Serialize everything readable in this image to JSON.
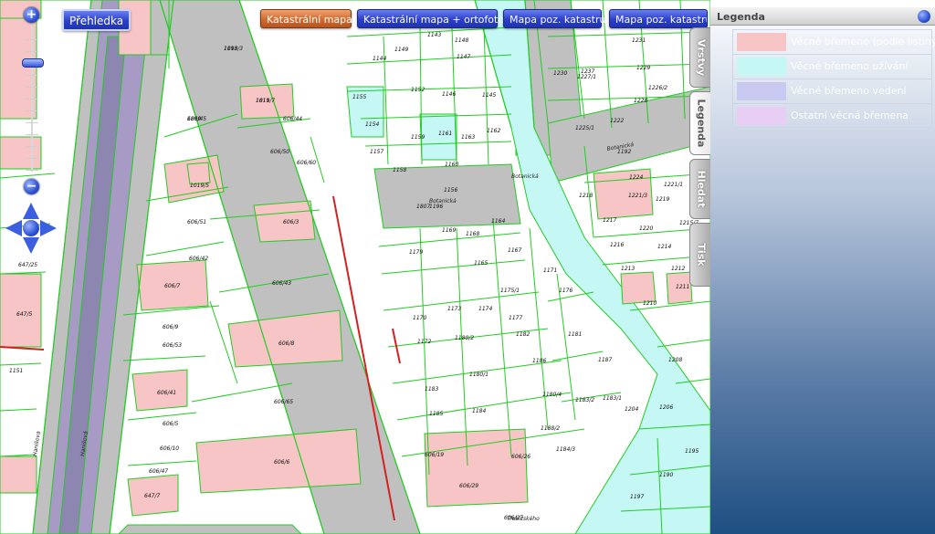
{
  "toolbar": {
    "overview_label": "Přehledka",
    "layer_buttons": [
      {
        "label": "Katastrální mapa",
        "active": true
      },
      {
        "label": "Katastrální mapa + ortofoto",
        "active": false
      },
      {
        "label": "Mapa poz. katastru",
        "active": false
      },
      {
        "label": "Mapa poz. katastru",
        "active": false
      }
    ]
  },
  "zoom": {
    "plus": "+",
    "minus": "−"
  },
  "side_tabs": [
    {
      "label": "Vrstvy",
      "active": false
    },
    {
      "label": "Legenda",
      "active": true
    },
    {
      "label": "Hledat",
      "active": false
    },
    {
      "label": "Tisk",
      "active": false
    }
  ],
  "legend": {
    "title": "Legenda",
    "items": [
      {
        "label": "Věcné břemeno (podle listiny)",
        "color": "#f7c5c5"
      },
      {
        "label": "Věcné břemeno užívání",
        "color": "#c5f7f5"
      },
      {
        "label": "Věcné břemeno vedení",
        "color": "#c9c9f2"
      },
      {
        "label": "Ostatní věcná břemena",
        "color": "#e8cdf5"
      }
    ]
  },
  "map": {
    "parcel_labels": [
      "1018/3",
      "1019/7",
      "606/45",
      "606/44",
      "606/50",
      "606/60",
      "1019/5",
      "606/51",
      "606/3",
      "606/42",
      "606/7",
      "606/43",
      "606/9",
      "606/53",
      "606/8",
      "606/41",
      "606/5",
      "606/65",
      "606/10",
      "606/6",
      "606/47",
      "647/7",
      "647/25",
      "647/5",
      "1151",
      "1149",
      "1152",
      "1144",
      "1148",
      "1143",
      "1147",
      "1146",
      "1145",
      "1155",
      "1154",
      "1159",
      "1161",
      "1163",
      "1162",
      "1157",
      "1158",
      "1160",
      "1156",
      "1807",
      "1164",
      "1179",
      "1169",
      "1168",
      "1165",
      "1167",
      "1171",
      "1175/1",
      "1173",
      "1176",
      "1170",
      "1172",
      "1174",
      "1177",
      "1182",
      "1180/2",
      "1180/1",
      "1184",
      "1186",
      "1180/4",
      "1183",
      "1185",
      "1181",
      "1187",
      "1183/2",
      "1183/1",
      "1188/2",
      "606/19",
      "606/26",
      "606/29",
      "606/27",
      "1184/3",
      "1230",
      "1229",
      "1237",
      "1231",
      "1228",
      "1227/1",
      "1226/2",
      "1225/1",
      "1222",
      "1224",
      "1221/3",
      "1221/1",
      "1219",
      "1218",
      "1220",
      "1215/7",
      "1217",
      "1216",
      "1214",
      "1213",
      "1212",
      "1211",
      "1210",
      "1208",
      "1204",
      "1206",
      "1197",
      "1190",
      "1195",
      "1192",
      "1196",
      "1193",
      "1811",
      "1809"
    ],
    "street_labels": [
      "Hanišová",
      "Botanická",
      "Botanická",
      "Botanická",
      "Třebízského",
      "Hanišova"
    ],
    "colors": {
      "pink": "#f7c5c5",
      "cyan": "#c5f7f5",
      "road": "#c0c0c0",
      "tram": "#a79bc6",
      "boundary": "#22cc22"
    }
  }
}
